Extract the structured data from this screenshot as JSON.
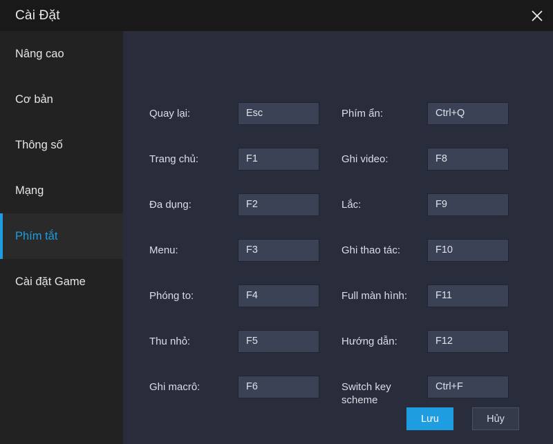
{
  "window": {
    "title": "Cài Đặt",
    "close_icon": "close-icon"
  },
  "colors": {
    "accent": "#1e9de0",
    "titlebar_bg": "#191919",
    "sidebar_bg": "#222222",
    "panel_bg": "#282c3b",
    "input_bg": "#3c4255",
    "input_border": "#21242f"
  },
  "sidebar": {
    "items": [
      {
        "label": "Nâng cao",
        "active": false
      },
      {
        "label": "Cơ bản",
        "active": false
      },
      {
        "label": "Thông số",
        "active": false
      },
      {
        "label": "Mạng",
        "active": false
      },
      {
        "label": "Phím tắt",
        "active": true
      },
      {
        "label": "Cài đặt Game",
        "active": false
      }
    ]
  },
  "main": {
    "left_column": [
      {
        "label": "Quay lại:",
        "value": "Esc"
      },
      {
        "label": "Trang chủ:",
        "value": "F1"
      },
      {
        "label": "Đa dụng:",
        "value": "F2"
      },
      {
        "label": "Menu:",
        "value": "F3"
      },
      {
        "label": "Phóng to:",
        "value": "F4"
      },
      {
        "label": "Thu nhỏ:",
        "value": "F5"
      },
      {
        "label": "Ghi macrô:",
        "value": "F6"
      }
    ],
    "right_column": [
      {
        "label": "Phím ẩn:",
        "value": "Ctrl+Q"
      },
      {
        "label": "Ghi video:",
        "value": "F8"
      },
      {
        "label": "Lắc:",
        "value": "F9"
      },
      {
        "label": "Ghi thao tác:",
        "value": "F10"
      },
      {
        "label": "Full màn hình:",
        "value": "F11"
      },
      {
        "label": "Hướng dẫn:",
        "value": "F12"
      },
      {
        "label": "Switch key\nscheme",
        "value": "Ctrl+F"
      }
    ]
  },
  "footer": {
    "save_label": "Lưu",
    "cancel_label": "Hủy"
  }
}
